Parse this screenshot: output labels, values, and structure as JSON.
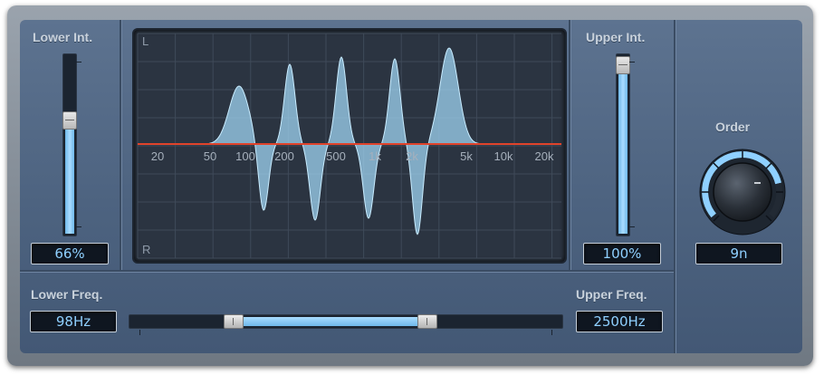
{
  "plugin": {
    "lower_int": {
      "label": "Lower Int.",
      "value": "66%",
      "level": 0.66
    },
    "upper_int": {
      "label": "Upper Int.",
      "value": "100%",
      "level": 1.0
    },
    "order": {
      "label": "Order",
      "value": "9n"
    },
    "lower_freq": {
      "label": "Lower Freq.",
      "value": "98Hz"
    },
    "upper_freq": {
      "label": "Upper Freq.",
      "value": "2500Hz"
    },
    "display": {
      "channel_top": "L",
      "channel_bottom": "R",
      "freq_labels": [
        "20",
        "50",
        "100",
        "200",
        "500",
        "1k",
        "2k",
        "5k",
        "10k",
        "20k"
      ]
    }
  },
  "colors": {
    "accent": "#8fd0ff",
    "waveform": "#9fd3f2",
    "center_line": "#e0432b",
    "panel": "#526884"
  }
}
